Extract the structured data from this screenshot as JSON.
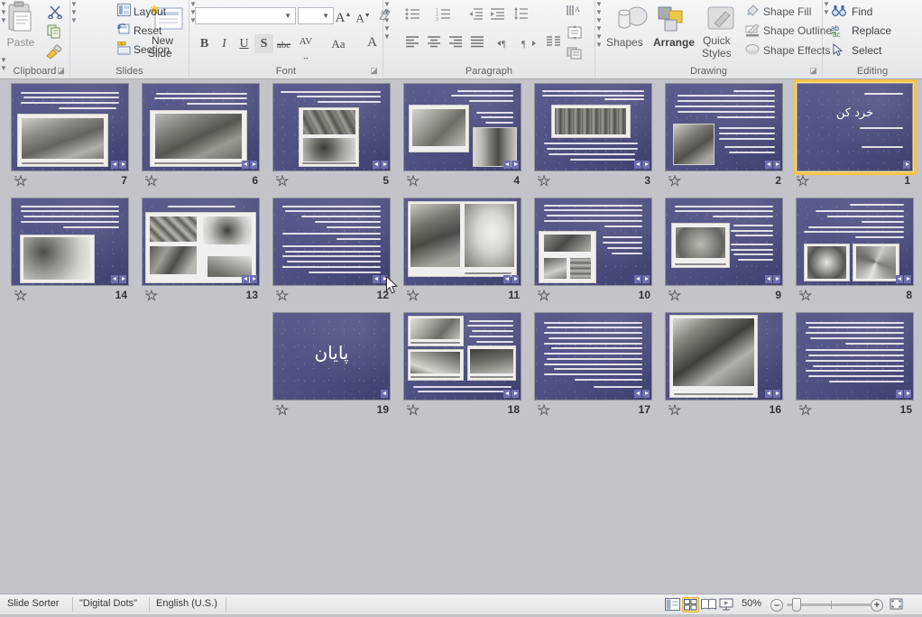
{
  "ribbon": {
    "groups": [
      {
        "name": "Clipboard",
        "label": "Clipboard"
      },
      {
        "name": "Slides",
        "label": "Slides"
      },
      {
        "name": "Font",
        "label": "Font"
      },
      {
        "name": "Paragraph",
        "label": "Paragraph"
      },
      {
        "name": "Drawing",
        "label": "Drawing"
      },
      {
        "name": "Editing",
        "label": "Editing"
      }
    ],
    "clipboard": {
      "paste_label": "Paste",
      "cut_icon": "scissors-icon",
      "copy_icon": "copy-icon",
      "format_painter_icon": "format-painter-icon"
    },
    "slides": {
      "new_slide_line1": "New",
      "new_slide_line2": "Slide",
      "layout_label": "Layout",
      "reset_label": "Reset",
      "section_label": "Section"
    },
    "font": {
      "font_name_value": "",
      "font_size_value": "",
      "grow_font_label": "A",
      "shrink_font_label": "A",
      "clear_formatting_icon": "clear-formatting-icon",
      "bold_label": "B",
      "italic_label": "I",
      "underline_label": "U",
      "shadow_label": "S",
      "strikethrough_label": "abc",
      "character_spacing_label": "AV",
      "change_case_label": "Aa",
      "font_color_label": "A"
    },
    "paragraph": {
      "bullets_icon": "bullets-icon",
      "numbering_icon": "numbering-icon",
      "decrease_indent_icon": "decrease-indent-icon",
      "increase_indent_icon": "increase-indent-icon",
      "line_spacing_icon": "line-spacing-icon",
      "text_direction_icon": "text-direction-icon",
      "align_left_icon": "align-left-icon",
      "align_center_icon": "align-center-icon",
      "align_right_icon": "align-right-icon",
      "justify_icon": "justify-icon",
      "ltr_icon": "left-to-right-icon",
      "rtl_icon": "right-to-left-icon",
      "columns_icon": "columns-icon",
      "align_text_icon": "align-text-icon",
      "convert_smartart_icon": "convert-to-smartart-icon"
    },
    "drawing": {
      "shapes_label": "Shapes",
      "arrange_label": "Arrange",
      "quick_styles_line1": "Quick",
      "quick_styles_line2": "Styles",
      "shape_fill_label": "Shape Fill",
      "shape_outline_label": "Shape Outline",
      "shape_effects_label": "Shape Effects"
    },
    "editing": {
      "find_label": "Find",
      "replace_label": "Replace",
      "select_label": "Select",
      "find_icon": "binoculars-icon",
      "replace_icon": "replace-icon",
      "select_icon": "cursor-arrow-icon"
    }
  },
  "workspace": {
    "slides": [
      {
        "number": "7",
        "layout": "text-top-photo-bottom"
      },
      {
        "number": "6",
        "layout": "text-top-photo-bottom"
      },
      {
        "number": "5",
        "layout": "text-top-two-photo"
      },
      {
        "number": "4",
        "layout": "two-photo-text-right"
      },
      {
        "number": "3",
        "layout": "text-photo-text"
      },
      {
        "number": "2",
        "layout": "text-heavy-photo-left"
      },
      {
        "number": "1",
        "layout": "title-slide",
        "selected": true,
        "title": "خرد کن",
        "bullets": [
          "عنوان تحقیق :",
          "اسامی ارائه دهندگان :",
          "تهیه کننده :"
        ]
      },
      {
        "number": "14",
        "layout": "text-top-photo-left"
      },
      {
        "number": "13",
        "layout": "photo-grid"
      },
      {
        "number": "12",
        "layout": "text-only"
      },
      {
        "number": "11",
        "layout": "two-photo-wide"
      },
      {
        "number": "10",
        "layout": "text-top-photo-collage"
      },
      {
        "number": "9",
        "layout": "photo-left-text-right"
      },
      {
        "number": "8",
        "layout": "text-top-two-photo-bottom"
      },
      {
        "number": "19",
        "layout": "end-slide",
        "title": "پایان"
      },
      {
        "number": "18",
        "layout": "photo-collage-text"
      },
      {
        "number": "17",
        "layout": "text-only"
      },
      {
        "number": "16",
        "layout": "large-photo"
      },
      {
        "number": "15",
        "layout": "text-only"
      }
    ],
    "star_icon": "animation-star-icon",
    "nav_icon": "slide-transition-icon"
  },
  "statusbar": {
    "view_name": "Slide Sorter",
    "theme_name": "\"Digital Dots\"",
    "language": "English (U.S.)",
    "zoom_percent": "50%",
    "zoom_out_label": "–",
    "zoom_in_label": "+",
    "views": [
      {
        "name": "normal-view",
        "icon": "normal-view-icon",
        "active": false
      },
      {
        "name": "slide-sorter-view",
        "icon": "slide-sorter-icon",
        "active": true
      },
      {
        "name": "reading-view",
        "icon": "reading-view-icon",
        "active": false
      },
      {
        "name": "slide-show-view",
        "icon": "slide-show-icon",
        "active": false
      }
    ],
    "fit_window_icon": "fit-slide-to-window-icon"
  },
  "colors": {
    "accent": "#f5c34a",
    "slide_bg": "#4e5082",
    "workspace_bg": "#c1c4c8",
    "ribbon_bg": "#eceef0"
  }
}
